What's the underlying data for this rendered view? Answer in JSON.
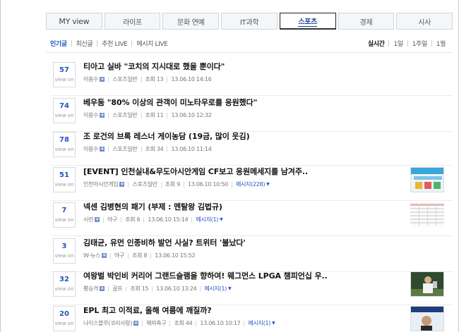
{
  "tabs": [
    {
      "label": "MY view",
      "active": false
    },
    {
      "label": "라이프",
      "active": false
    },
    {
      "label": "문화 연예",
      "active": false
    },
    {
      "label": "IT과학",
      "active": false
    },
    {
      "label": "스포츠",
      "active": true
    },
    {
      "label": "경제",
      "active": false
    },
    {
      "label": "시사",
      "active": false
    }
  ],
  "sort_tabs": [
    "인기글",
    "최신글",
    "추천 LIVE",
    "메시지 LIVE"
  ],
  "period_tabs": [
    "실시간",
    "1일",
    "1주일",
    "1월"
  ],
  "view_on_label": "view on",
  "hits_label": "조회",
  "message_label": "메시지",
  "articles": [
    {
      "count": "57",
      "title": "티아고 실바 \"코치의 지시대로 했을 뿐이다\"",
      "author": "이용수",
      "category": "스포츠일반",
      "hits": "13",
      "date": "13.06.10 14:16"
    },
    {
      "count": "74",
      "title": "베우둠 \"80% 이상의 관객이 미노타우로를 응원했다\"",
      "author": "이용수",
      "category": "스포츠일반",
      "hits": "11",
      "date": "13.06.10 12:32"
    },
    {
      "count": "78",
      "title": "조 로건의 브록 레스너 게이농담 (19금, 많이 웃김)",
      "author": "이용수",
      "category": "스포츠일반",
      "hits": "34",
      "date": "13.06.10 11:14"
    },
    {
      "count": "51",
      "title": "[EVENT] 인천실내&무도아시안게임 CF보고 응원메세지를 남겨주..",
      "author": "인천아시안게임",
      "category": "스포츠일반",
      "hits": "9",
      "date": "13.06.10 10:50",
      "messages": "228"
    },
    {
      "count": "7",
      "title": "넥센 김병현의 패기 (부제 : 멘탈왕 김법규)",
      "author": "시련",
      "category": "야구",
      "hits": "6",
      "date": "13.06.10 15:14",
      "messages": "1"
    },
    {
      "count": "3",
      "title": "김태균, 유먼 인종비하 발언 사실? 트위터 '불났다'",
      "author": "W-뉴스",
      "category": "야구",
      "hits": "8",
      "date": "13.06.10 15:52"
    },
    {
      "count": "32",
      "title": "여왕벌 박인비 커리어 그랜드슬램을 향하여! 웨그먼스 LPGA 챔피언십 우..",
      "author": "황승격",
      "category": "골프",
      "hits": "15",
      "date": "13.06.10 13:24",
      "messages": "1"
    },
    {
      "count": "20",
      "title": "EPL 최고 이적료, 올해 여름에 깨질까?",
      "author": "나이스블루(코리사랑)",
      "category": "해외축구",
      "hits": "44",
      "date": "13.06.10 10:17",
      "messages": "1"
    }
  ]
}
